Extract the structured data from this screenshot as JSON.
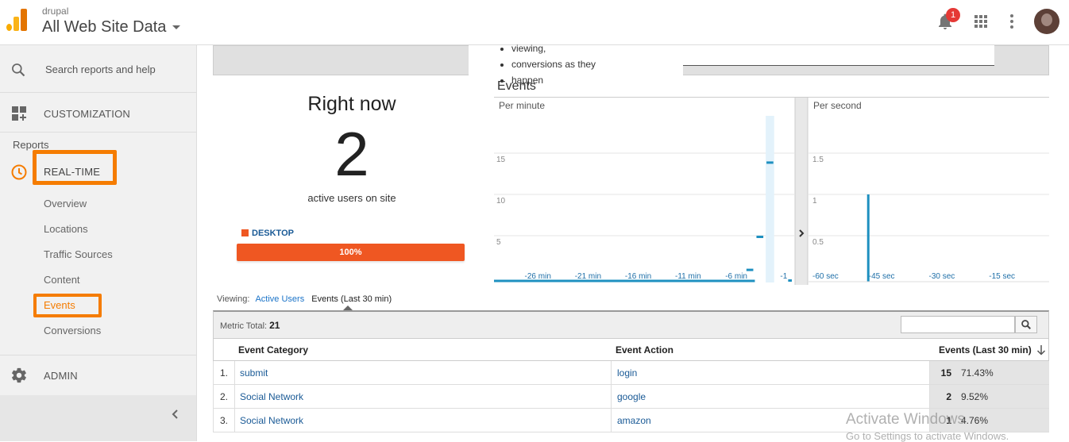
{
  "header": {
    "account": "drupal",
    "property": "All Web Site Data",
    "notification_count": "1",
    "icons": [
      "analytics-logo-icon",
      "notifications-bell-icon",
      "apps-grid-icon",
      "more-vert-icon",
      "user-avatar"
    ]
  },
  "sidebar": {
    "search_placeholder": "Search reports and help",
    "customization": "CUSTOMIZATION",
    "reports_heading": "Reports",
    "realtime": "REAL-TIME",
    "items": [
      {
        "label": "Overview"
      },
      {
        "label": "Locations"
      },
      {
        "label": "Traffic Sources"
      },
      {
        "label": "Content"
      },
      {
        "label": "Events",
        "active": true
      },
      {
        "label": "Conversions"
      }
    ],
    "admin": "ADMIN",
    "accent_color": "#f57c00"
  },
  "tip": {
    "bullets": [
      "viewing,",
      "conversions as they",
      "happen"
    ]
  },
  "summary": {
    "title": "Right now",
    "active_users": "2",
    "caption": "active users on site",
    "device_label": "DESKTOP",
    "device_percent": "100%",
    "device_share": 1.0,
    "device_color": "#ef5722"
  },
  "events_panel": {
    "title": "Events",
    "per_minute_label": "Per minute",
    "per_second_label": "Per second"
  },
  "chart_data": [
    {
      "type": "bar",
      "title": "Per minute",
      "x_ticks": [
        "-26 min",
        "-21 min",
        "-16 min",
        "-11 min",
        "-6 min",
        "-1"
      ],
      "y_ticks": [
        "15",
        "10",
        "5"
      ],
      "ylim": [
        0,
        20
      ],
      "x": [
        -30,
        -29,
        -28,
        -27,
        -26,
        -25,
        -24,
        -23,
        -22,
        -21,
        -20,
        -19,
        -18,
        -17,
        -16,
        -15,
        -14,
        -13,
        -12,
        -11,
        -10,
        -9,
        -8,
        -7,
        -6,
        -5,
        -4,
        -3,
        -2,
        -1
      ],
      "values": [
        0,
        0,
        0,
        0,
        0,
        0,
        0,
        0,
        0,
        0,
        0,
        0,
        0,
        0,
        0,
        0,
        0,
        0,
        0,
        0,
        0,
        0,
        0,
        0,
        0,
        0,
        1,
        5,
        14,
        0
      ],
      "color": "#1e90c0"
    },
    {
      "type": "bar",
      "title": "Per second",
      "x_ticks": [
        "-60 sec",
        "-45 sec",
        "-30 sec",
        "-15 sec"
      ],
      "y_ticks": [
        "1.5",
        "1",
        "0.5"
      ],
      "ylim": [
        0,
        2
      ],
      "spike": {
        "x": -45,
        "value": 1
      },
      "color": "#1e90c0"
    }
  ],
  "viewing": {
    "label": "Viewing:",
    "tab_active_users": "Active Users",
    "tab_events": "Events (Last 30 min)"
  },
  "table": {
    "metric_total_label": "Metric Total:",
    "metric_total_value": "21",
    "columns": [
      "Event Category",
      "Event Action",
      "Events (Last 30 min)"
    ],
    "rows": [
      {
        "index": "1.",
        "category": "submit",
        "action": "login",
        "events": "15",
        "percent": "71.43%"
      },
      {
        "index": "2.",
        "category": "Social Network",
        "action": "google",
        "events": "2",
        "percent": "9.52%"
      },
      {
        "index": "3.",
        "category": "Social Network",
        "action": "amazon",
        "events": "1",
        "percent": "4.76%"
      }
    ]
  },
  "watermark": {
    "line1": "Activate Windows",
    "line2": "Go to Settings to activate Windows."
  }
}
